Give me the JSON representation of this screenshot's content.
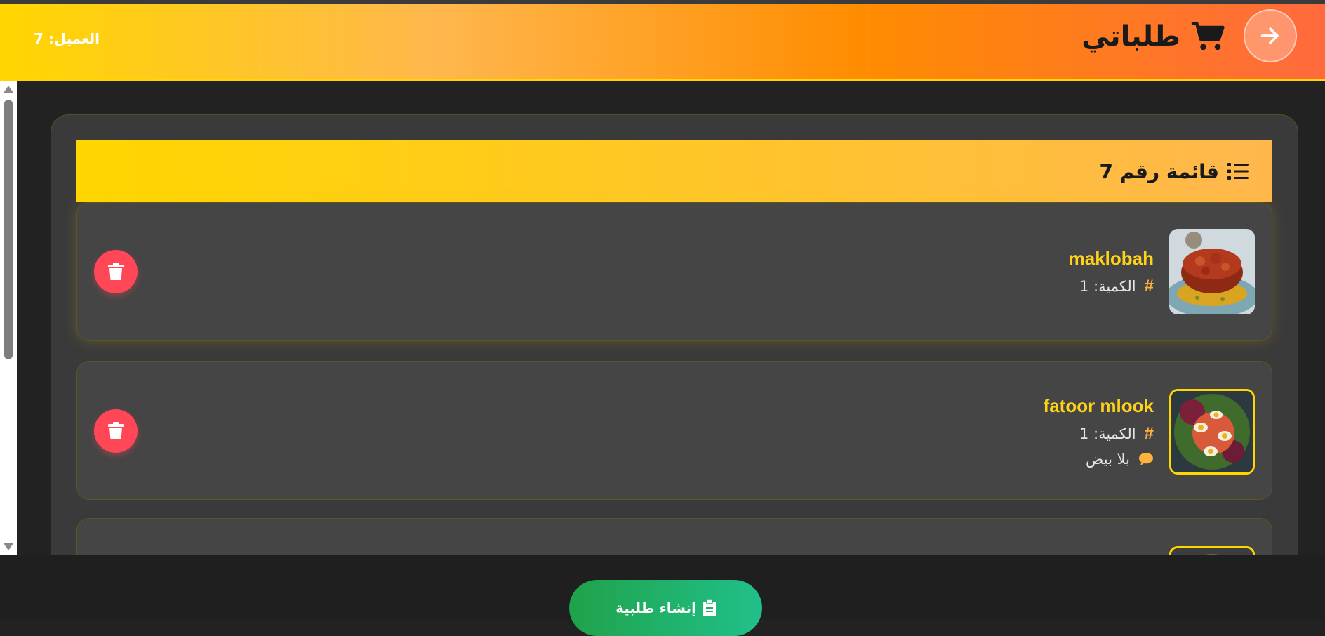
{
  "header": {
    "title": "طلباتي",
    "customer_label": "العميل: 7",
    "back_icon": "arrow-right-icon",
    "cart_icon": "cart-icon"
  },
  "list": {
    "title": "قائمة رقم 7",
    "icon": "list-icon",
    "items": [
      {
        "name": "maklobah",
        "quantity": "الكمية: 1",
        "note": ""
      },
      {
        "name": "fatoor mlook",
        "quantity": "الكمية: 1",
        "note": "بلا بيض"
      }
    ]
  },
  "footer": {
    "create_label": "إنشاء طلبية",
    "create_icon": "clipboard-icon"
  },
  "colors": {
    "accent": "#ffd600",
    "orange": "#ff8c00",
    "danger": "#ff4757",
    "success": "#1fa24a"
  }
}
